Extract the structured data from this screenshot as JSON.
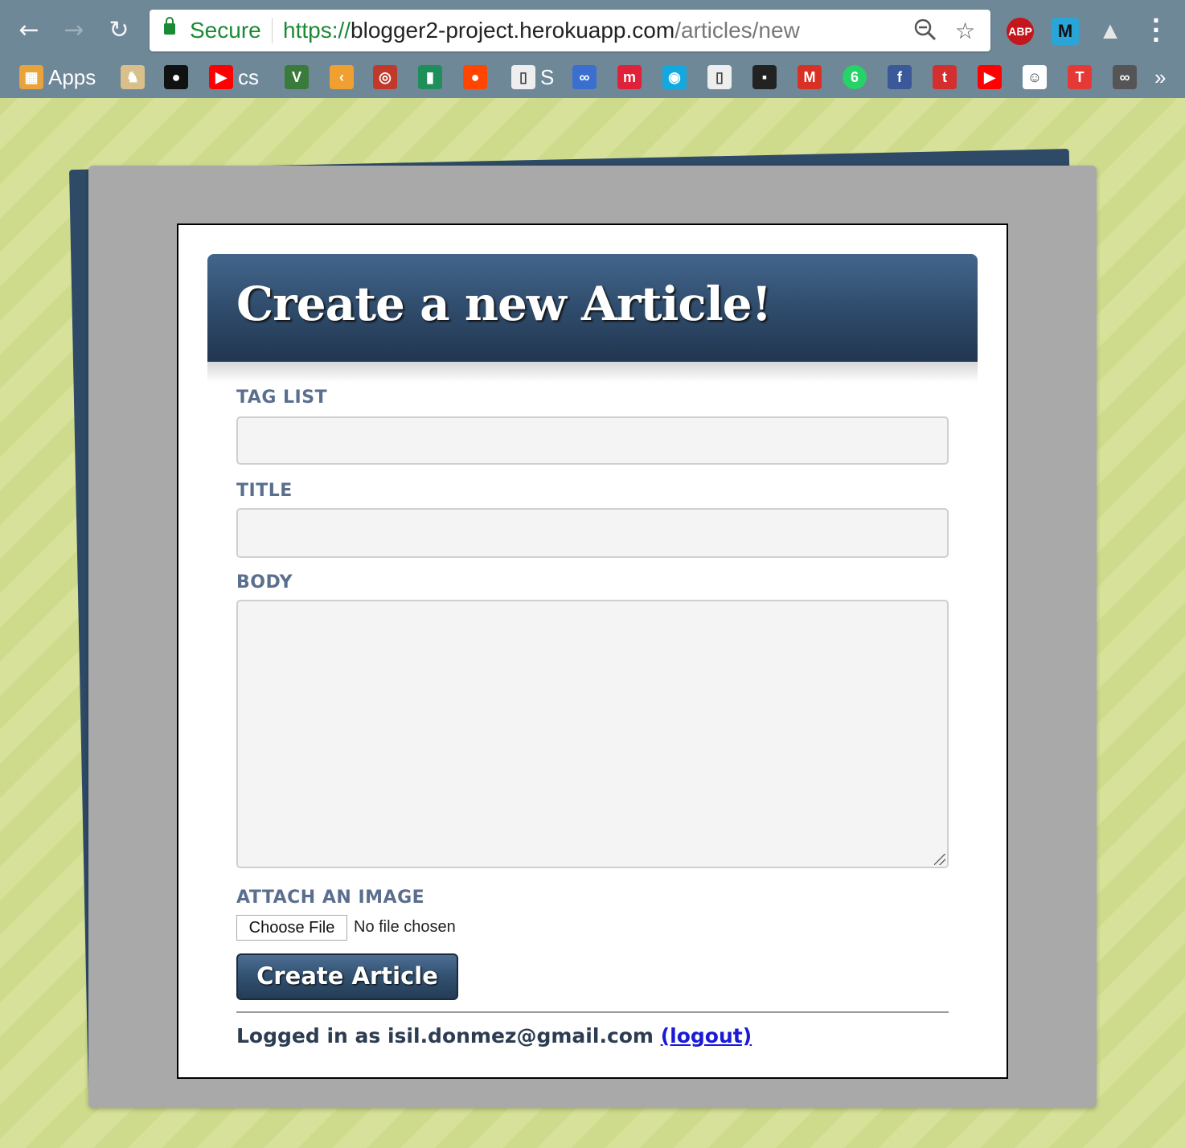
{
  "browser": {
    "secure_label": "Secure",
    "url_scheme": "https://",
    "url_host": "blogger2-project.herokuapp.com",
    "url_path": "/articles/new",
    "extensions": [
      "ABP",
      "M"
    ]
  },
  "bookmarks": [
    {
      "label": "Apps",
      "icon": "apps-grid-icon",
      "color": "#e8a33d"
    },
    {
      "label": "",
      "icon": "viking-icon",
      "color": "#d9c08a"
    },
    {
      "label": "",
      "icon": "github-icon",
      "color": "#111111"
    },
    {
      "label": "cs",
      "icon": "youtube-icon",
      "color": "#ff0000"
    },
    {
      "label": "",
      "icon": "vim-icon",
      "color": "#3a7a3a"
    },
    {
      "label": "",
      "icon": "leetcode-icon",
      "color": "#f0a030"
    },
    {
      "label": "",
      "icon": "sololearn-icon",
      "color": "#c0392b"
    },
    {
      "label": "",
      "icon": "bars-icon",
      "color": "#1e8f5a"
    },
    {
      "label": "",
      "icon": "reddit-icon",
      "color": "#ff4500"
    },
    {
      "label": "S",
      "icon": "page-icon",
      "color": "#eeeeee"
    },
    {
      "label": "",
      "icon": "infinity-icon",
      "color": "#3a6fd0"
    },
    {
      "label": "",
      "icon": "m-icon",
      "color": "#e0213a"
    },
    {
      "label": "",
      "icon": "ring-icon",
      "color": "#14a8e0"
    },
    {
      "label": "",
      "icon": "page-icon",
      "color": "#eeeeee"
    },
    {
      "label": "",
      "icon": "bbc-icon",
      "color": "#222222"
    },
    {
      "label": "",
      "icon": "gmail-icon",
      "color": "#d93025"
    },
    {
      "label": "",
      "icon": "whatsapp-icon",
      "color": "#25d366",
      "badge": "6"
    },
    {
      "label": "",
      "icon": "facebook-icon",
      "color": "#3b5998"
    },
    {
      "label": "",
      "icon": "tumblr-icon",
      "color": "#d32f2f"
    },
    {
      "label": "",
      "icon": "youtube-icon",
      "color": "#ff0000"
    },
    {
      "label": "",
      "icon": "people-icon",
      "color": "#ffffff"
    },
    {
      "label": "",
      "icon": "t-icon",
      "color": "#e53935"
    },
    {
      "label": "",
      "icon": "infinity-icon",
      "color": "#555555"
    }
  ],
  "bookmarks_overflow": "»",
  "form": {
    "heading": "Create a new Article!",
    "tag_list_label": "TAG LIST",
    "tag_list_value": "",
    "title_label": "TITLE",
    "title_value": "",
    "body_label": "BODY",
    "body_value": "",
    "image_label": "ATTACH AN IMAGE",
    "choose_file": "Choose File",
    "file_status": "No file chosen",
    "submit": "Create Article"
  },
  "footer": {
    "logged_in_text": "Logged in as isil.donmez@gmail.com",
    "logout": "(logout)"
  }
}
